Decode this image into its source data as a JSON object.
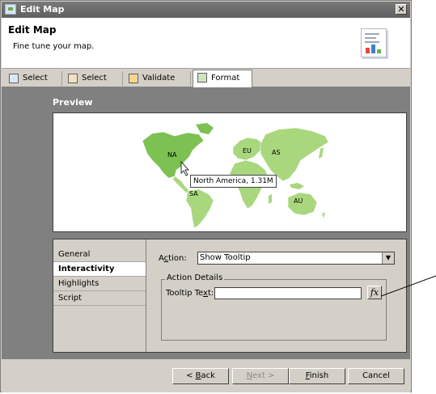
{
  "window": {
    "title": "Edit Map",
    "close_glyph": "✕"
  },
  "header": {
    "title": "Edit Map",
    "subtitle": "Fine tune your map."
  },
  "tabs": [
    {
      "label": "Select Map",
      "icon": "select-map-icon"
    },
    {
      "label": "Select Data",
      "icon": "select-data-icon"
    },
    {
      "label": "Validate Data",
      "icon": "validate-data-icon"
    },
    {
      "label": "Format Map",
      "icon": "format-map-icon",
      "active": true
    }
  ],
  "preview": {
    "label": "Preview",
    "regions": [
      {
        "code": "NA",
        "color": "#7cc152"
      },
      {
        "code": "SA",
        "color": "#a9d77e"
      },
      {
        "code": "EU",
        "color": "#a9d77e"
      },
      {
        "code": "AS",
        "color": "#a9d77e"
      },
      {
        "code": "AU",
        "color": "#a9d77e"
      }
    ],
    "tooltip": "North America, 1.31M"
  },
  "nav": {
    "items": [
      "General",
      "Interactivity",
      "Highlights",
      "Script"
    ],
    "active": "Interactivity"
  },
  "action": {
    "label_pre": "A",
    "label_u": "c",
    "label_post": "tion:",
    "value": "Show Tooltip"
  },
  "details": {
    "group_title": "Action Details",
    "tooltip_label_pre": "Tooltip Te",
    "tooltip_label_u": "x",
    "tooltip_label_post": "t:",
    "tooltip_value": "",
    "fx_label": "fx"
  },
  "footer": {
    "back_pre": "< ",
    "back_u": "B",
    "back_post": "ack",
    "next_pre": "",
    "next_u": "N",
    "next_post": "ext >",
    "finish_pre": "",
    "finish_u": "F",
    "finish_post": "inish",
    "cancel": "Cancel"
  }
}
